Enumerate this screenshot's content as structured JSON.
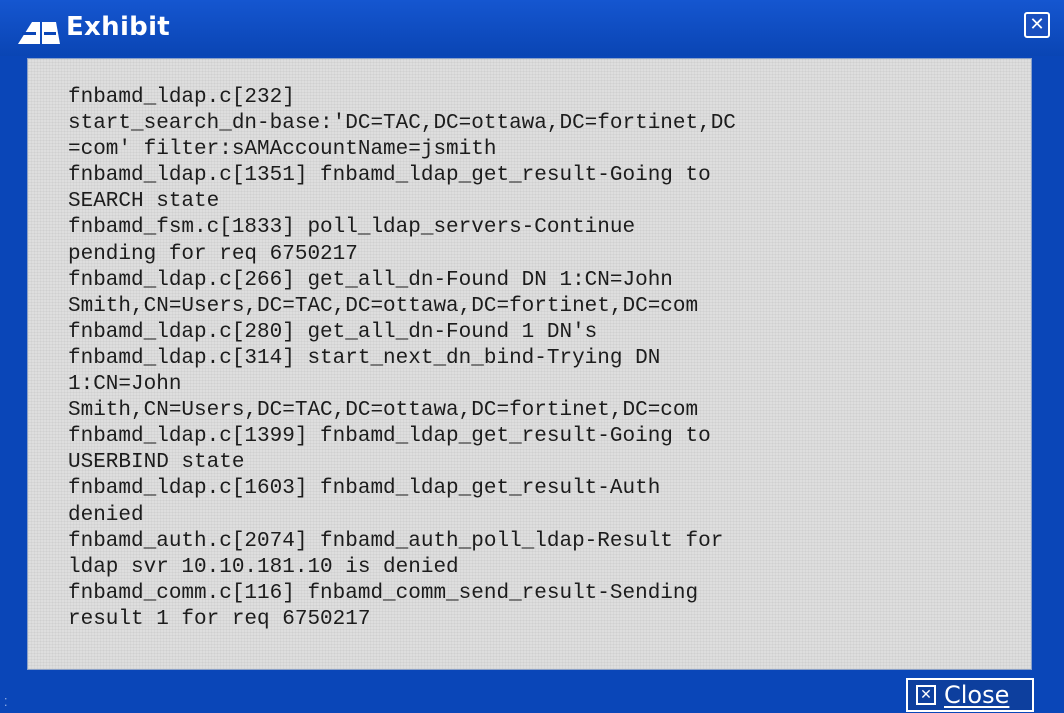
{
  "window": {
    "title": "Exhibit",
    "title_close_glyph": "✕",
    "icon": "exhibit-icon"
  },
  "log_lines": [
    "fnbamd_ldap.c[232]",
    "start_search_dn-base:'DC=TAC,DC=ottawa,DC=fortinet,DC",
    "=com' filter:sAMAccountName=jsmith",
    "fnbamd_ldap.c[1351] fnbamd_ldap_get_result-Going to",
    "SEARCH state",
    "fnbamd_fsm.c[1833] poll_ldap_servers-Continue",
    "pending for req 6750217",
    "fnbamd_ldap.c[266] get_all_dn-Found DN 1:CN=John",
    "Smith,CN=Users,DC=TAC,DC=ottawa,DC=fortinet,DC=com",
    "fnbamd_ldap.c[280] get_all_dn-Found 1 DN's",
    "fnbamd_ldap.c[314] start_next_dn_bind-Trying DN",
    "1:CN=John",
    "Smith,CN=Users,DC=TAC,DC=ottawa,DC=fortinet,DC=com",
    "fnbamd_ldap.c[1399] fnbamd_ldap_get_result-Going to",
    "USERBIND state",
    "fnbamd_ldap.c[1603] fnbamd_ldap_get_result-Auth",
    "denied",
    "fnbamd_auth.c[2074] fnbamd_auth_poll_ldap-Result for",
    "ldap svr 10.10.181.10 is denied",
    "fnbamd_comm.c[116] fnbamd_comm_send_result-Sending",
    "result 1 for req 6750217"
  ],
  "footer": {
    "close_label": "Close",
    "close_glyph": "✕"
  },
  "colors": {
    "titlebar": "#0a46b8",
    "content_bg": "#dedede",
    "text": "#1c1c1c"
  }
}
